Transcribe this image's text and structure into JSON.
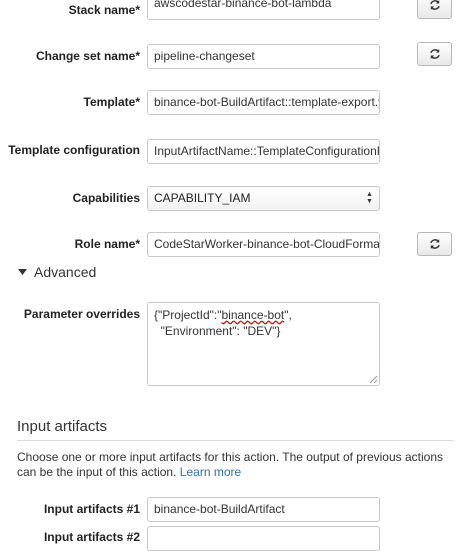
{
  "form": {
    "stack_name": {
      "label": "Stack name*",
      "value": "awscodestar-binance-bot-lambda"
    },
    "change_set_name": {
      "label": "Change set name*",
      "value": "pipeline-changeset"
    },
    "template": {
      "label": "Template*",
      "value": "binance-bot-BuildArtifact::template-export.yml"
    },
    "template_configuration": {
      "label": "Template configuration",
      "value": "InputArtifactName::TemplateConfigurationFile"
    },
    "capabilities": {
      "label": "Capabilities",
      "value": "CAPABILITY_IAM"
    },
    "role_name": {
      "label": "Role name*",
      "value": "CodeStarWorker-binance-bot-CloudFormation"
    }
  },
  "advanced": {
    "title": "Advanced",
    "parameter_overrides": {
      "label": "Parameter overrides",
      "line1_a": "{\"ProjectId\":\"",
      "line1_b": "binance-bot",
      "line1_c": "\",",
      "line2": "  \"Environment\": \"DEV\"}"
    }
  },
  "input_artifacts": {
    "title": "Input artifacts",
    "description": "Choose one or more input artifacts for this action. The output of previous actions can be the input of this action.",
    "learn_more": "Learn more",
    "artifact1": {
      "label": "Input artifacts #1",
      "value": "binance-bot-BuildArtifact"
    },
    "artifact2": {
      "label": "Input artifacts #2",
      "value": ""
    }
  },
  "icons": {
    "refresh": "refresh-icon",
    "expand": "caret-down-icon"
  },
  "colors": {
    "link": "#2a6fb0",
    "text": "#222222",
    "border": "#c8c8c8"
  }
}
